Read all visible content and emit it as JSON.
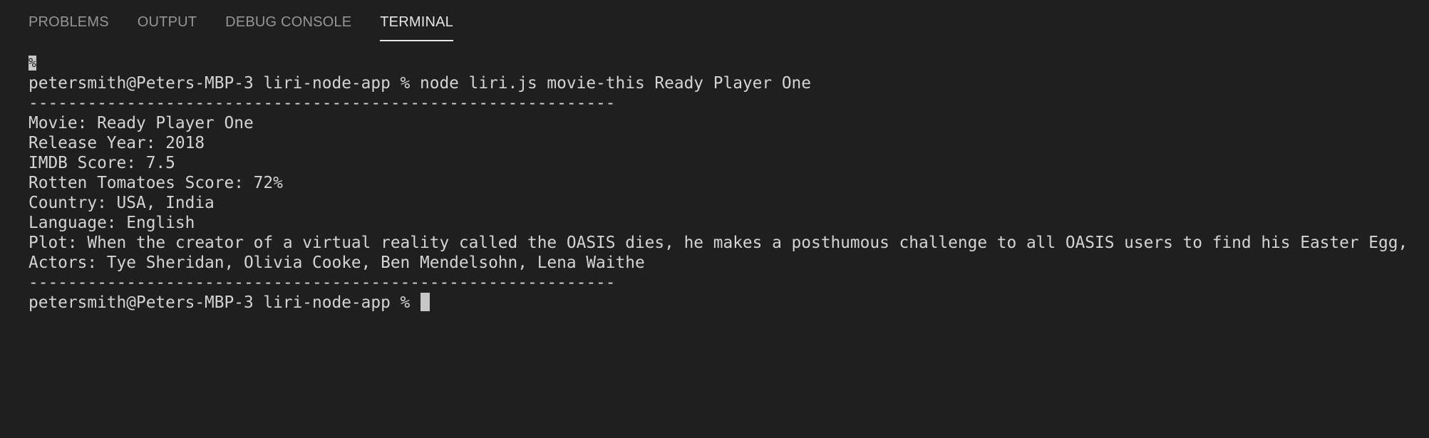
{
  "panel": {
    "tabs": [
      {
        "label": "PROBLEMS"
      },
      {
        "label": "OUTPUT"
      },
      {
        "label": "DEBUG CONSOLE"
      },
      {
        "label": "TERMINAL"
      }
    ],
    "active_tab": "TERMINAL"
  },
  "terminal": {
    "partial_marker": "%",
    "prompt": "petersmith@Peters-MBP-3 liri-node-app % ",
    "command": "node liri.js movie-this Ready Player One",
    "separator": "------------------------------------------------------------",
    "output": [
      "Movie: Ready Player One",
      "Release Year: 2018",
      "IMDB Score: 7.5",
      "Rotten Tomatoes Score: 72%",
      "Country: USA, India",
      "Language: English",
      "Plot: When the creator of a virtual reality called the OASIS dies, he makes a posthumous challenge to all OASIS users to find his Easter Egg,",
      "Actors: Tye Sheridan, Olivia Cooke, Ben Mendelsohn, Lena Waithe"
    ],
    "final_prompt": "petersmith@Peters-MBP-3 liri-node-app % "
  }
}
